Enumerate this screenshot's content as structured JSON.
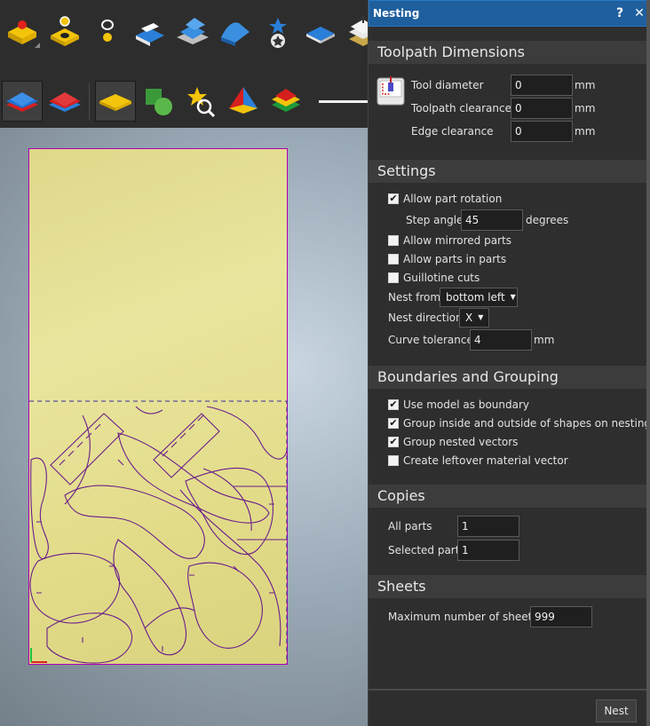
{
  "toolbar": {
    "row1": [
      {
        "name": "set-zero-icon"
      },
      {
        "name": "material-setup-icon"
      },
      {
        "name": "z-zero-icon"
      },
      {
        "name": "import-component-icon"
      },
      {
        "name": "layered-model-icon"
      },
      {
        "name": "sculpt-icon"
      },
      {
        "name": "add-star-icon"
      },
      {
        "name": "flat-plane-icon"
      },
      {
        "name": "stack-tools-icon"
      }
    ],
    "row2": [
      {
        "name": "layers-blue-icon",
        "active": true
      },
      {
        "name": "layers-red-icon",
        "active": false
      },
      {
        "name": "yellow-plate-icon",
        "active": true
      },
      {
        "name": "shapes-icon",
        "active": false
      },
      {
        "name": "zoom-star-icon",
        "active": false
      },
      {
        "name": "pyramid-icon",
        "active": false
      },
      {
        "name": "color-layers-icon",
        "active": false
      }
    ]
  },
  "panel": {
    "title": "Nesting",
    "help_glyph": "?",
    "close_glyph": "✕",
    "toolpath": {
      "header": "Toolpath Dimensions",
      "tool_diameter_label": "Tool diameter",
      "tool_diameter_value": "0",
      "toolpath_clearance_label": "Toolpath clearance",
      "toolpath_clearance_value": "0",
      "edge_clearance_label": "Edge clearance",
      "edge_clearance_value": "0",
      "unit": "mm"
    },
    "settings": {
      "header": "Settings",
      "allow_rotation": {
        "label": "Allow part rotation",
        "checked": true
      },
      "step_angle_label": "Step angle",
      "step_angle_value": "45",
      "step_angle_unit": "degrees",
      "allow_mirrored": {
        "label": "Allow mirrored parts",
        "checked": false
      },
      "allow_parts_in_parts": {
        "label": "Allow parts in parts",
        "checked": false
      },
      "guillotine": {
        "label": "Guillotine cuts",
        "checked": false
      },
      "nest_from_label": "Nest from",
      "nest_from_value": "bottom left",
      "nest_direction_label": "Nest direction",
      "nest_direction_value": "X",
      "curve_tolerance_label": "Curve tolerance",
      "curve_tolerance_value": "4",
      "curve_tolerance_unit": "mm"
    },
    "boundaries": {
      "header": "Boundaries and Grouping",
      "use_model": {
        "label": "Use model as boundary",
        "checked": true
      },
      "group_inside": {
        "label": "Group inside and outside of shapes on nesting",
        "checked": true
      },
      "group_nested": {
        "label": "Group nested vectors",
        "checked": true
      },
      "leftover": {
        "label": "Create leftover material vector",
        "checked": false
      }
    },
    "copies": {
      "header": "Copies",
      "all_parts_label": "All parts",
      "all_parts_value": "1",
      "selected_part_label": "Selected part",
      "selected_part_value": "1"
    },
    "sheets": {
      "header": "Sheets",
      "max_label": "Maximum number of sheets",
      "max_value": "999"
    },
    "nest_button": "Nest"
  },
  "colors": {
    "titlebar": "#1f5f9e",
    "sheet_border": "#b000b0",
    "vector": "#6a1d8a"
  }
}
